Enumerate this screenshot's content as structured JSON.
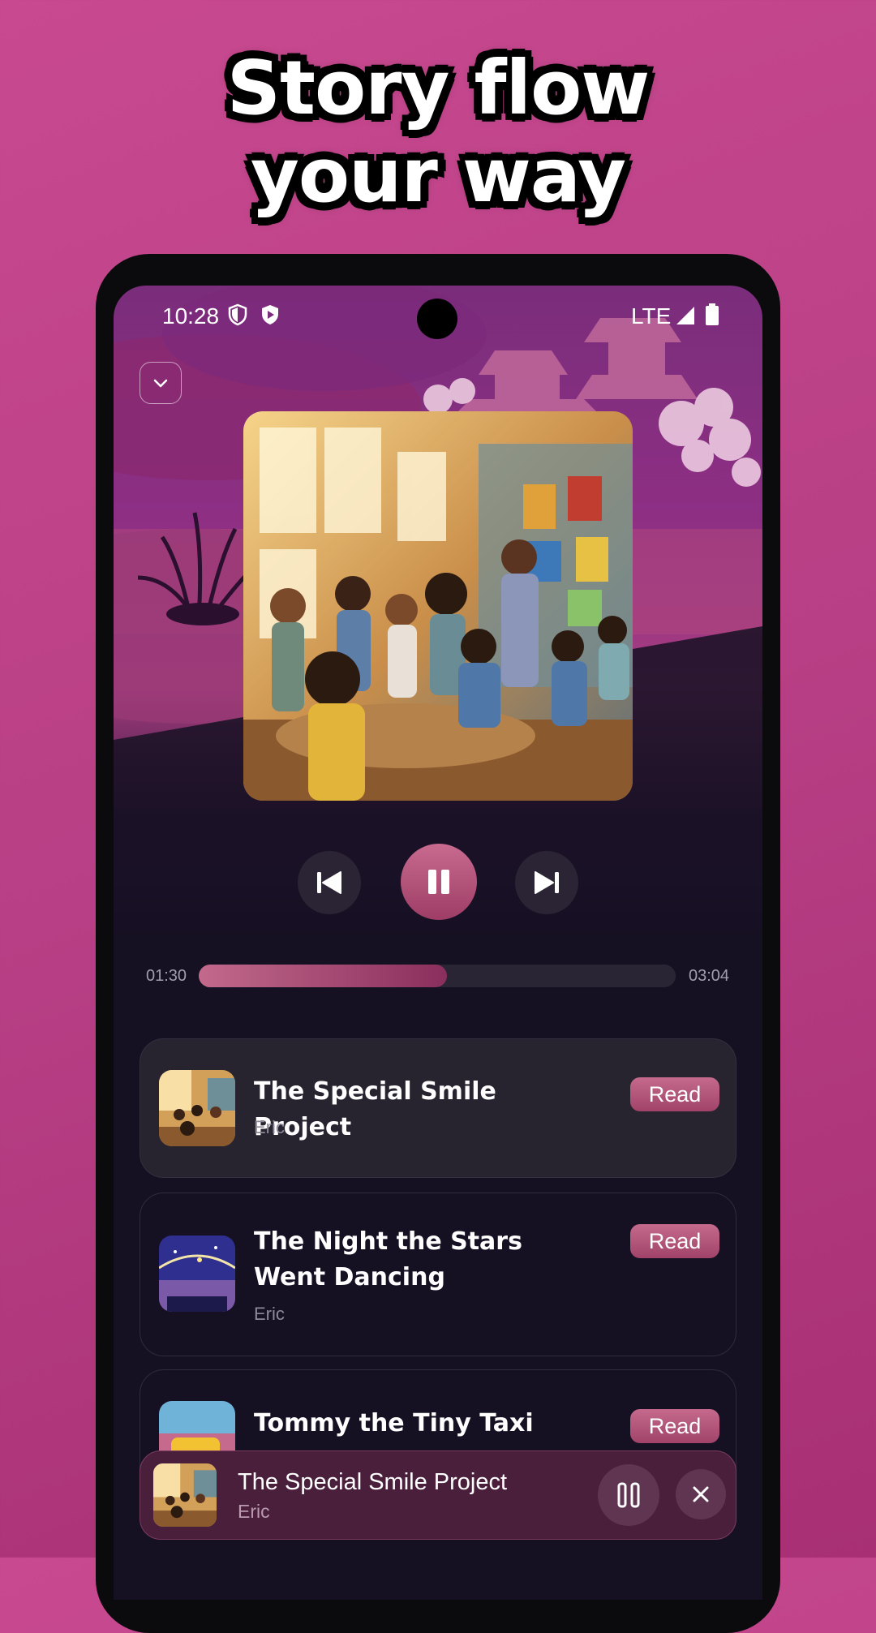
{
  "headline": {
    "line1": "Story flow",
    "line2": "your way"
  },
  "status_bar": {
    "time": "10:28",
    "network": "LTE"
  },
  "player": {
    "current_time": "01:30",
    "total_time": "03:04",
    "progress": 0.52
  },
  "stories": [
    {
      "title": "The Special Smile Project",
      "author": "Eric",
      "action": "Read"
    },
    {
      "title": "The Night the Stars Went Dancing",
      "author": "Eric",
      "action": "Read"
    },
    {
      "title": "Tommy the Tiny Taxi",
      "author": "",
      "action": "Read"
    }
  ],
  "mini_player": {
    "title": "The Special Smile Project",
    "author": "Eric"
  },
  "colors": {
    "accent": "#b5577d",
    "background": "#161023",
    "page_background": "#c2448a"
  }
}
